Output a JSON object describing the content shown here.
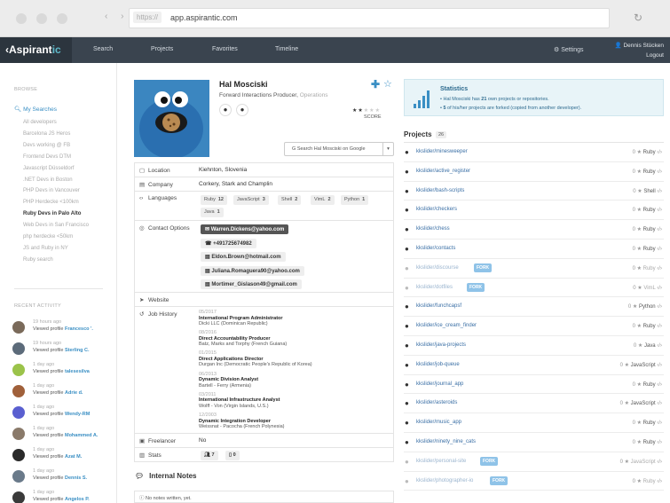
{
  "browser": {
    "scheme": "https://",
    "host": "app.aspirantic.com",
    "nav_arrows": "‹ ›",
    "reload_icon": "reload-icon"
  },
  "nav": {
    "logo_main": "Aspirant",
    "logo_accent": "ic",
    "items": [
      "Search",
      "Projects",
      "Favorites",
      "Timeline"
    ],
    "settings": "Settings",
    "user": "Dennis Stücken",
    "logout": "Logout"
  },
  "sidebar": {
    "browse_heading": "BROWSE",
    "my_searches": "My Searches",
    "searches": [
      "All developers",
      "Barcelona JS Heros",
      "Devs working @ FB",
      "Frontend Devs DTM",
      "Javascript Düsseldorf",
      ".NET Devs in Boston",
      "PHP Devs in Vancouver",
      "PHP Herdecke <100km",
      "Ruby Devs in Palo Alto",
      "Web Devs in San Francisco",
      "php herdecke <50km",
      "JS and Ruby in NY",
      "Ruby search"
    ],
    "active_search": "Ruby Devs in Palo Alto",
    "recent_heading": "RECENT ACTIVITY",
    "activity": [
      {
        "time": "19 hours ago",
        "prefix": "Viewed profile",
        "name": "Francesco '.",
        "avatar_color": "#7a6a5a"
      },
      {
        "time": "19 hours ago",
        "prefix": "Viewed profile",
        "name": "Sterling C.",
        "avatar_color": "#5c6b7a"
      },
      {
        "time": "1 day ago",
        "prefix": "Viewed profile",
        "name": "talesesilva",
        "avatar_color": "#9bc34a"
      },
      {
        "time": "1 day ago",
        "prefix": "Viewed profile",
        "name": "Adrie d.",
        "avatar_color": "#a0603a"
      },
      {
        "time": "1 day ago",
        "prefix": "Viewed profile",
        "name": "Wendy-RM",
        "avatar_color": "#5a5fd0"
      },
      {
        "time": "1 day ago",
        "prefix": "Viewed profile",
        "name": "Mohammed A.",
        "avatar_color": "#8a7a6a"
      },
      {
        "time": "1 day ago",
        "prefix": "Viewed profile",
        "name": "Azat M.",
        "avatar_color": "#2a2a2a"
      },
      {
        "time": "1 day ago",
        "prefix": "Viewed profile",
        "name": "Dennis S.",
        "avatar_color": "#6a7a8a"
      },
      {
        "time": "1 day ago",
        "prefix": "Viewed profile",
        "name": "Angelos P.",
        "avatar_color": "#3a3a3a"
      }
    ]
  },
  "profile": {
    "name": "Hal Mosciski",
    "role": "Forward Interactions Producer,",
    "role_dept": "Operations",
    "score_label": "SCORE",
    "rating": 2,
    "rating_max": 5,
    "google_button": "Search Hal Mosciski on Google",
    "location_label": "Location",
    "location": "Kiehnton, Slovenia",
    "company_label": "Company",
    "company": "Corkery, Stark and Champlin",
    "languages_label": "Languages",
    "languages": [
      {
        "name": "Ruby",
        "count": "12"
      },
      {
        "name": "JavaScript",
        "count": "3"
      },
      {
        "name": "Shell",
        "count": "2"
      },
      {
        "name": "VimL",
        "count": "2"
      },
      {
        "name": "Python",
        "count": "1"
      },
      {
        "name": "Java",
        "count": "1"
      }
    ],
    "contact_label": "Contact Options",
    "contacts": [
      "Warren.Dickens@yahoo.com",
      "+491725674982",
      "Eldon.Brown@hotmail.com",
      "Juliana.Romaguera90@yahoo.com",
      "Mortimer_Gislason49@gmail.com"
    ],
    "website_label": "Website",
    "job_label": "Job History",
    "jobs": [
      {
        "date": "05/2017",
        "title": "International Program Administrator",
        "org": "Dicki LLC (Dominican Republic)"
      },
      {
        "date": "08/2016",
        "title": "Direct Accountability Producer",
        "org": "Batz, Marks and Torphy (French Guiana)"
      },
      {
        "date": "01/2015",
        "title": "Direct Applications Director",
        "org": "Durgan Inc (Democratic People's Republic of Korea)"
      },
      {
        "date": "06/2013",
        "title": "Dynamic Division Analyst",
        "org": "Bartell - Ferry (Armenia)"
      },
      {
        "date": "03/2011",
        "title": "International Infrastructure Analyst",
        "org": "Wolff - Von (Virgin Islands, U.S.)"
      },
      {
        "date": "12/2003",
        "title": "Dynamic Integration Developer",
        "org": "Weissnat - Pacocha (French Polynesia)"
      }
    ],
    "freelancer_label": "Freelancer",
    "freelancer": "No",
    "stats_label": "Stats",
    "stats_people": "7",
    "stats_docs": "0",
    "notes_heading": "Internal Notes",
    "notes_empty": "No notes written, yet."
  },
  "statistics": {
    "title": "Statistics",
    "line1_pre": "Hal Mosciski has ",
    "line1_num": "21",
    "line1_post": " own projects or repositories.",
    "line2_num": "5",
    "line2_post": " of his/her projects are forked (copied from another developer)."
  },
  "projects": {
    "heading": "Projects",
    "count": "26",
    "fork_label": "FORK",
    "items": [
      {
        "name": "kkslider/minesweeper",
        "stars": "0",
        "lang": "Ruby",
        "fork": false
      },
      {
        "name": "kkslider/active_register",
        "stars": "0",
        "lang": "Ruby",
        "fork": false
      },
      {
        "name": "kkslider/bash-scripts",
        "stars": "0",
        "lang": "Shell",
        "fork": false
      },
      {
        "name": "kkslider/checkers",
        "stars": "0",
        "lang": "Ruby",
        "fork": false
      },
      {
        "name": "kkslider/chess",
        "stars": "0",
        "lang": "Ruby",
        "fork": false
      },
      {
        "name": "kkslider/contacts",
        "stars": "0",
        "lang": "Ruby",
        "fork": false
      },
      {
        "name": "kkslider/discourse",
        "stars": "0",
        "lang": "Ruby",
        "fork": true
      },
      {
        "name": "kkslider/dotfiles",
        "stars": "0",
        "lang": "VimL",
        "fork": true
      },
      {
        "name": "kkslider/funchcapsf",
        "stars": "0",
        "lang": "Python",
        "fork": false
      },
      {
        "name": "kkslider/ice_cream_finder",
        "stars": "0",
        "lang": "Ruby",
        "fork": false
      },
      {
        "name": "kkslider/java-projects",
        "stars": "0",
        "lang": "Java",
        "fork": false
      },
      {
        "name": "kkslider/job-queue",
        "stars": "0",
        "lang": "JavaScript",
        "fork": false
      },
      {
        "name": "kkslider/journal_app",
        "stars": "0",
        "lang": "Ruby",
        "fork": false
      },
      {
        "name": "kkslider/asteroids",
        "stars": "0",
        "lang": "JavaScript",
        "fork": false
      },
      {
        "name": "kkslider/music_app",
        "stars": "0",
        "lang": "Ruby",
        "fork": false
      },
      {
        "name": "kkslider/ninety_nine_cats",
        "stars": "0",
        "lang": "Ruby",
        "fork": false
      },
      {
        "name": "kkslider/personal-site",
        "stars": "0",
        "lang": "JavaScript",
        "fork": true
      },
      {
        "name": "kkslider/photographer-io",
        "stars": "0",
        "lang": "Ruby",
        "fork": true
      }
    ]
  },
  "colors": {
    "nav_bg": "#3a444f",
    "accent": "#3a8fc4",
    "stat_bg": "#e8f4f8"
  }
}
